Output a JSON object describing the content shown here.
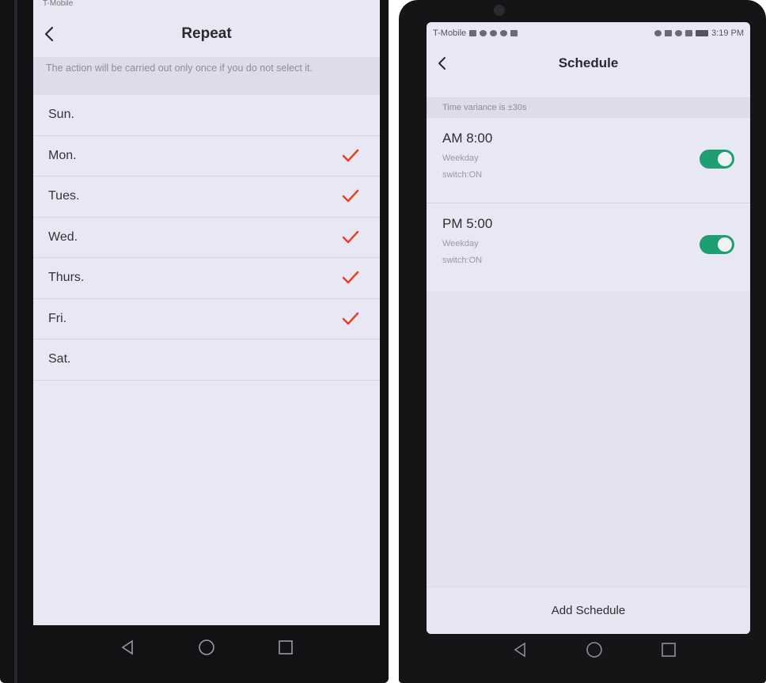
{
  "repeat_screen": {
    "status_carrier": "T-Mobile",
    "title": "Repeat",
    "hint": "The action will be carried out only once if you do not select it.",
    "days": [
      {
        "label": "Sun.",
        "checked": false
      },
      {
        "label": "Mon.",
        "checked": true
      },
      {
        "label": "Tues.",
        "checked": true
      },
      {
        "label": "Wed.",
        "checked": true
      },
      {
        "label": "Thurs.",
        "checked": true
      },
      {
        "label": "Fri.",
        "checked": true
      },
      {
        "label": "Sat.",
        "checked": false
      }
    ],
    "check_color": "#e8412c"
  },
  "schedule_screen": {
    "status_bar": {
      "carrier": "T-Mobile",
      "time": "3:19 PM"
    },
    "title": "Schedule",
    "variance": "Time variance is ±30s",
    "schedules": [
      {
        "time": "AM 8:00",
        "repeat": "Weekday",
        "action": "switch:ON",
        "enabled": true
      },
      {
        "time": "PM 5:00",
        "repeat": "Weekday",
        "action": "switch:ON",
        "enabled": true
      }
    ],
    "add_label": "Add Schedule",
    "toggle_color": "#1f9e76"
  },
  "icons": {
    "back": "chevron-left-icon",
    "check": "check-icon",
    "nav_back": "triangle-back-icon",
    "nav_home": "circle-home-icon",
    "nav_recent": "square-recent-icon"
  }
}
